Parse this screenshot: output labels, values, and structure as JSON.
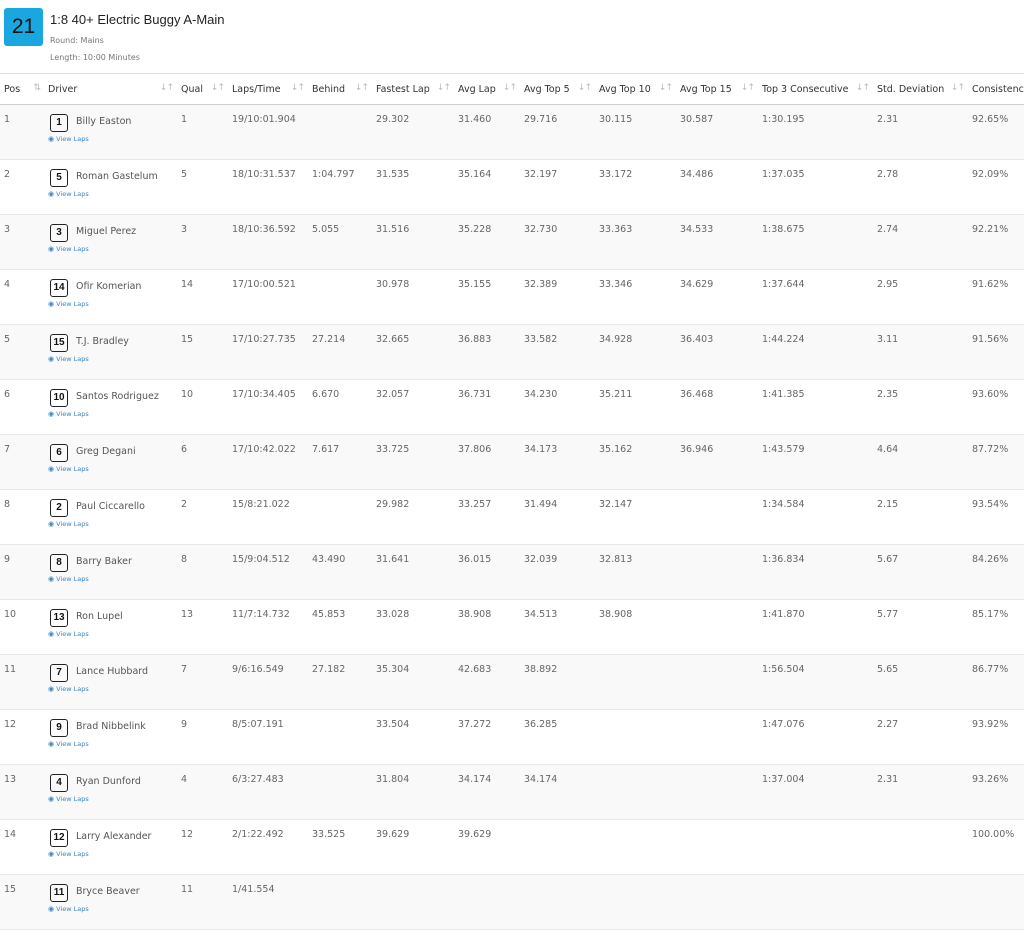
{
  "race": {
    "number": "21",
    "title": "1:8 40+ Electric Buggy A-Main",
    "round": "Round: Mains",
    "length": "Length: 10:00 Minutes"
  },
  "columns": [
    "Pos",
    "Driver",
    "Qual",
    "Laps/Time",
    "Behind",
    "Fastest Lap",
    "Avg Lap",
    "Avg Top 5",
    "Avg Top 10",
    "Avg Top 15",
    "Top 3 Consecutive",
    "Std. Deviation",
    "Consistency"
  ],
  "view_laps_label": "View Laps",
  "rows": [
    {
      "pos": "1",
      "car": "1",
      "driver": "Billy Easton",
      "qual": "1",
      "laps": "19/10:01.904",
      "behind": "",
      "fastest": "29.302",
      "avg": "31.460",
      "top5": "29.716",
      "top10": "30.115",
      "top15": "30.587",
      "top3c": "1:30.195",
      "std": "2.31",
      "cons": "92.65%"
    },
    {
      "pos": "2",
      "car": "5",
      "driver": "Roman Gastelum",
      "qual": "5",
      "laps": "18/10:31.537",
      "behind": "1:04.797",
      "fastest": "31.535",
      "avg": "35.164",
      "top5": "32.197",
      "top10": "33.172",
      "top15": "34.486",
      "top3c": "1:37.035",
      "std": "2.78",
      "cons": "92.09%"
    },
    {
      "pos": "3",
      "car": "3",
      "driver": "Miguel Perez",
      "qual": "3",
      "laps": "18/10:36.592",
      "behind": "5.055",
      "fastest": "31.516",
      "avg": "35.228",
      "top5": "32.730",
      "top10": "33.363",
      "top15": "34.533",
      "top3c": "1:38.675",
      "std": "2.74",
      "cons": "92.21%"
    },
    {
      "pos": "4",
      "car": "14",
      "driver": "Ofir Komerian",
      "qual": "14",
      "laps": "17/10:00.521",
      "behind": "",
      "fastest": "30.978",
      "avg": "35.155",
      "top5": "32.389",
      "top10": "33.346",
      "top15": "34.629",
      "top3c": "1:37.644",
      "std": "2.95",
      "cons": "91.62%"
    },
    {
      "pos": "5",
      "car": "15",
      "driver": "T.J. Bradley",
      "qual": "15",
      "laps": "17/10:27.735",
      "behind": "27.214",
      "fastest": "32.665",
      "avg": "36.883",
      "top5": "33.582",
      "top10": "34.928",
      "top15": "36.403",
      "top3c": "1:44.224",
      "std": "3.11",
      "cons": "91.56%"
    },
    {
      "pos": "6",
      "car": "10",
      "driver": "Santos Rodriguez",
      "qual": "10",
      "laps": "17/10:34.405",
      "behind": "6.670",
      "fastest": "32.057",
      "avg": "36.731",
      "top5": "34.230",
      "top10": "35.211",
      "top15": "36.468",
      "top3c": "1:41.385",
      "std": "2.35",
      "cons": "93.60%"
    },
    {
      "pos": "7",
      "car": "6",
      "driver": "Greg Degani",
      "qual": "6",
      "laps": "17/10:42.022",
      "behind": "7.617",
      "fastest": "33.725",
      "avg": "37.806",
      "top5": "34.173",
      "top10": "35.162",
      "top15": "36.946",
      "top3c": "1:43.579",
      "std": "4.64",
      "cons": "87.72%"
    },
    {
      "pos": "8",
      "car": "2",
      "driver": "Paul Ciccarello",
      "qual": "2",
      "laps": "15/8:21.022",
      "behind": "",
      "fastest": "29.982",
      "avg": "33.257",
      "top5": "31.494",
      "top10": "32.147",
      "top15": "",
      "top3c": "1:34.584",
      "std": "2.15",
      "cons": "93.54%"
    },
    {
      "pos": "9",
      "car": "8",
      "driver": "Barry Baker",
      "qual": "8",
      "laps": "15/9:04.512",
      "behind": "43.490",
      "fastest": "31.641",
      "avg": "36.015",
      "top5": "32.039",
      "top10": "32.813",
      "top15": "",
      "top3c": "1:36.834",
      "std": "5.67",
      "cons": "84.26%"
    },
    {
      "pos": "10",
      "car": "13",
      "driver": "Ron Lupel",
      "qual": "13",
      "laps": "11/7:14.732",
      "behind": "45.853",
      "fastest": "33.028",
      "avg": "38.908",
      "top5": "34.513",
      "top10": "38.908",
      "top15": "",
      "top3c": "1:41.870",
      "std": "5.77",
      "cons": "85.17%"
    },
    {
      "pos": "11",
      "car": "7",
      "driver": "Lance Hubbard",
      "qual": "7",
      "laps": "9/6:16.549",
      "behind": "27.182",
      "fastest": "35.304",
      "avg": "42.683",
      "top5": "38.892",
      "top10": "",
      "top15": "",
      "top3c": "1:56.504",
      "std": "5.65",
      "cons": "86.77%"
    },
    {
      "pos": "12",
      "car": "9",
      "driver": "Brad Nibbelink",
      "qual": "9",
      "laps": "8/5:07.191",
      "behind": "",
      "fastest": "33.504",
      "avg": "37.272",
      "top5": "36.285",
      "top10": "",
      "top15": "",
      "top3c": "1:47.076",
      "std": "2.27",
      "cons": "93.92%"
    },
    {
      "pos": "13",
      "car": "4",
      "driver": "Ryan Dunford",
      "qual": "4",
      "laps": "6/3:27.483",
      "behind": "",
      "fastest": "31.804",
      "avg": "34.174",
      "top5": "34.174",
      "top10": "",
      "top15": "",
      "top3c": "1:37.004",
      "std": "2.31",
      "cons": "93.26%"
    },
    {
      "pos": "14",
      "car": "12",
      "driver": "Larry Alexander",
      "qual": "12",
      "laps": "2/1:22.492",
      "behind": "33.525",
      "fastest": "39.629",
      "avg": "39.629",
      "top5": "",
      "top10": "",
      "top15": "",
      "top3c": "",
      "std": "",
      "cons": "100.00%"
    },
    {
      "pos": "15",
      "car": "11",
      "driver": "Bryce Beaver",
      "qual": "11",
      "laps": "1/41.554",
      "behind": "",
      "fastest": "",
      "avg": "",
      "top5": "",
      "top10": "",
      "top15": "",
      "top3c": "",
      "std": "",
      "cons": ""
    }
  ]
}
